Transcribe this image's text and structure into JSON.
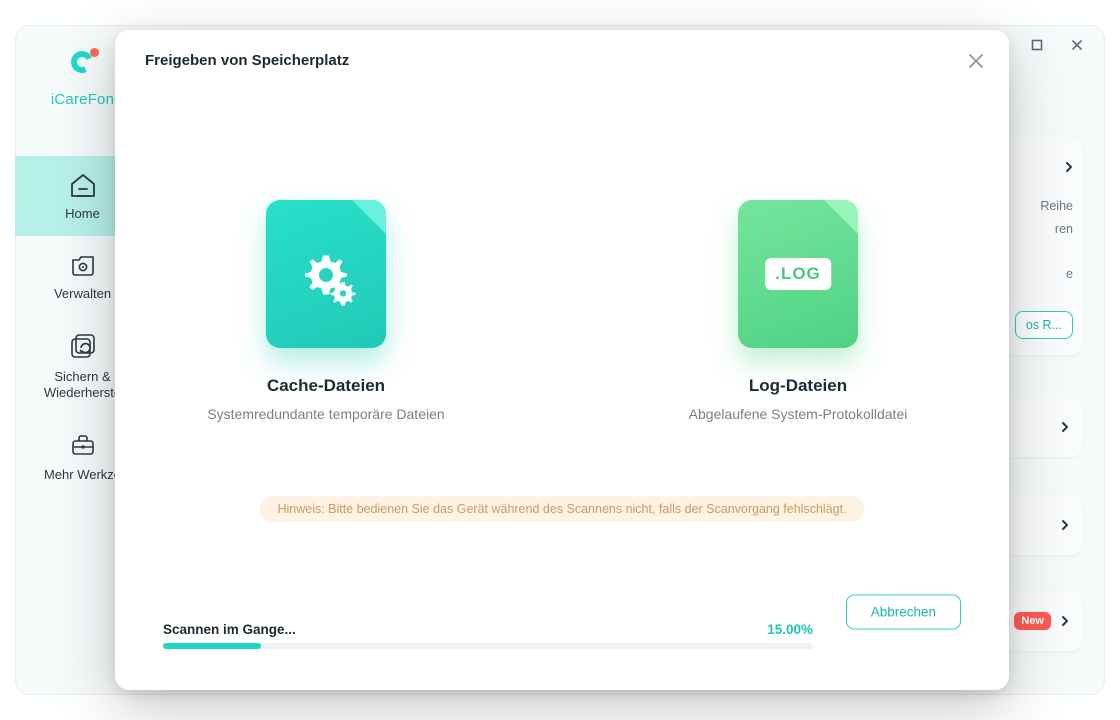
{
  "app": {
    "brand": "iCareFon"
  },
  "window_controls": {
    "minimize": "—",
    "maximize": "▢",
    "close": "✕"
  },
  "sidebar": {
    "items": [
      {
        "label": "Home",
        "icon": "home-icon",
        "active": true
      },
      {
        "label": "Verwalten",
        "icon": "manage-icon",
        "active": false
      },
      {
        "label": "Sichern &\nWiederherste",
        "icon": "backup-icon",
        "active": false
      },
      {
        "label": "Mehr Werkze",
        "icon": "tools-icon",
        "active": false
      }
    ]
  },
  "background_right": {
    "lines": "Reihe\nren\n\ne",
    "button": "os R...",
    "rows": [
      {
        "new_badge": null
      },
      {
        "new_badge": null
      },
      {
        "new_badge": "New"
      }
    ]
  },
  "modal": {
    "title": "Freigeben von Speicherplatz",
    "cards": {
      "cache": {
        "title": "Cache-Dateien",
        "subtitle": "Systemredundante temporäre Dateien"
      },
      "log": {
        "title": "Log-Dateien",
        "subtitle": "Abgelaufene System-Protokolldatei",
        "badge_text": ".LOG"
      }
    },
    "hint": "Hinweis: Bitte bedienen Sie das Gerät während des Scannens nicht, falls der Scanvorgang fehlschlägt.",
    "scan": {
      "label": "Scannen im Gange...",
      "percent_text": "15.00%",
      "percent_value": 15
    },
    "cancel_label": "Abbrechen"
  },
  "colors": {
    "accent": "#20d6c2",
    "green": "#55d487",
    "warn_bg": "#fff4e4"
  }
}
